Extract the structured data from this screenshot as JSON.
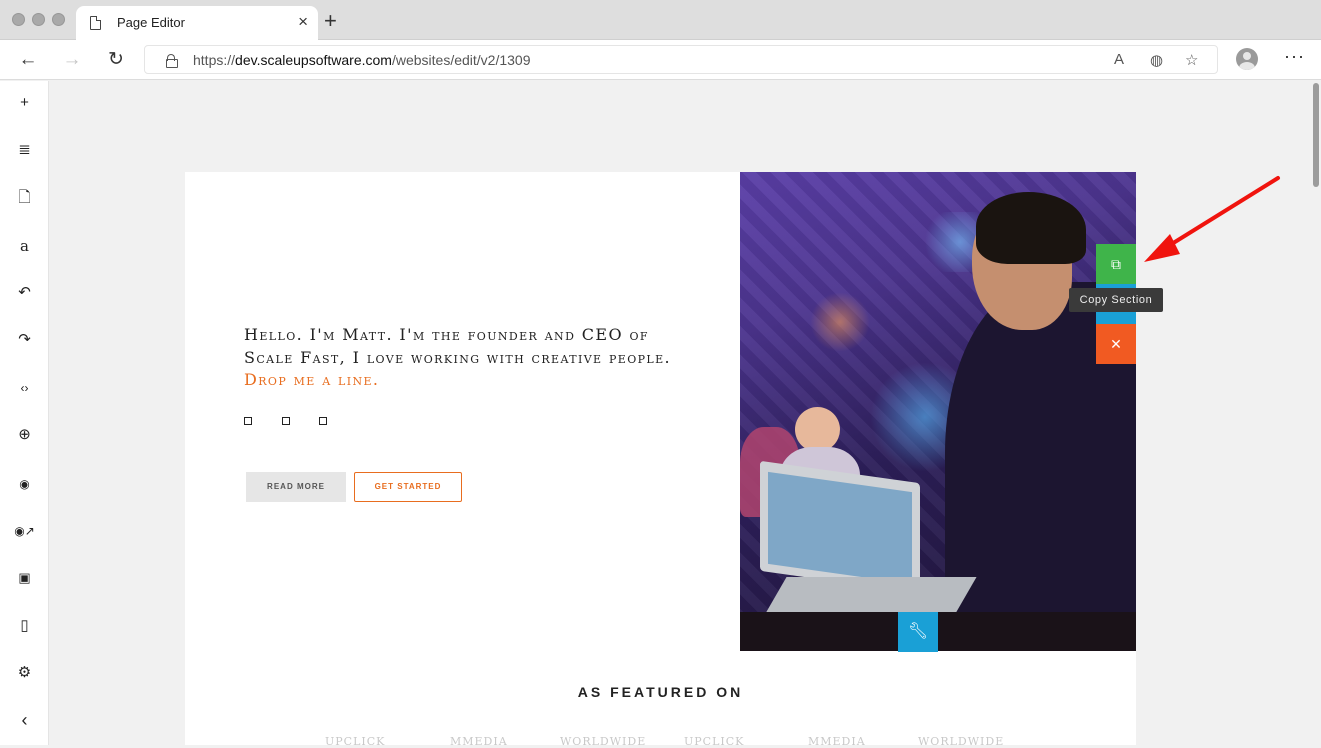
{
  "browser": {
    "tab_title": "Page Editor",
    "url_prefix": "https://",
    "url_domain": "dev.scaleupsoftware.com",
    "url_path": "/websites/edit/v2/1309"
  },
  "sidebar": {
    "items": [
      {
        "name": "add-icon",
        "glyph": "+"
      },
      {
        "name": "layers-icon",
        "glyph": "≣"
      },
      {
        "name": "page-icon",
        "glyph": "🗋"
      },
      {
        "name": "typography-icon",
        "glyph": "a"
      },
      {
        "name": "undo-icon",
        "glyph": "↶"
      },
      {
        "name": "redo-icon",
        "glyph": "↷"
      },
      {
        "name": "code-icon",
        "glyph": "‹›"
      },
      {
        "name": "zoom-icon",
        "glyph": "⊕"
      },
      {
        "name": "preview-icon",
        "glyph": "◉"
      },
      {
        "name": "preview-external-icon",
        "glyph": "◉↗"
      },
      {
        "name": "save-icon",
        "glyph": "▣"
      },
      {
        "name": "clipboard-icon",
        "glyph": "▯"
      },
      {
        "name": "settings-icon",
        "glyph": "⚙"
      },
      {
        "name": "collapse-icon",
        "glyph": "‹"
      }
    ]
  },
  "hero": {
    "line1": "Hello. I'm Matt. I'm the founder and CEO of",
    "line2": "Scale Fast, I love working with creative people.",
    "cta_link": "Drop me a line.",
    "read_more": "READ MORE",
    "get_started": "GET STARTED"
  },
  "controls": {
    "copy_tooltip": "Copy Section",
    "copy_icon": "⧉",
    "delete_icon": "✕",
    "wrench_icon": "🔧"
  },
  "featured": {
    "heading": "AS FEATURED ON",
    "logos": [
      "UPCLICK",
      "MMEDIA",
      "WORLDWIDE",
      "UPCLICK",
      "MMEDIA",
      "WORLDWIDE"
    ]
  },
  "colors": {
    "accent": "#e86d1f",
    "copy_green": "#3fb44a",
    "move_blue": "#1aa0d6",
    "delete_orange": "#f15a22",
    "arrow_red": "#f0140e"
  }
}
